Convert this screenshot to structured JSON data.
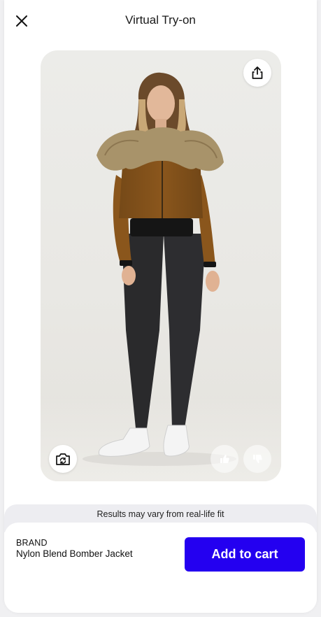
{
  "header": {
    "title": "Virtual Try-on",
    "close_icon": "close-icon"
  },
  "preview": {
    "share_icon": "share-icon",
    "camera_icon": "camera-flip-icon",
    "thumbs_up_icon": "thumbs-up-icon",
    "thumbs_down_icon": "thumbs-down-icon"
  },
  "notice": {
    "text": "Results may vary from real-life fit"
  },
  "product": {
    "brand": "BRAND",
    "name": "Nylon Blend Bomber Jacket",
    "add_to_cart_label": "Add to cart"
  },
  "colors": {
    "accent": "#2400f0",
    "jacket": "#8a561c",
    "fur": "#a8936a",
    "leggings": "#2a2a2c"
  }
}
